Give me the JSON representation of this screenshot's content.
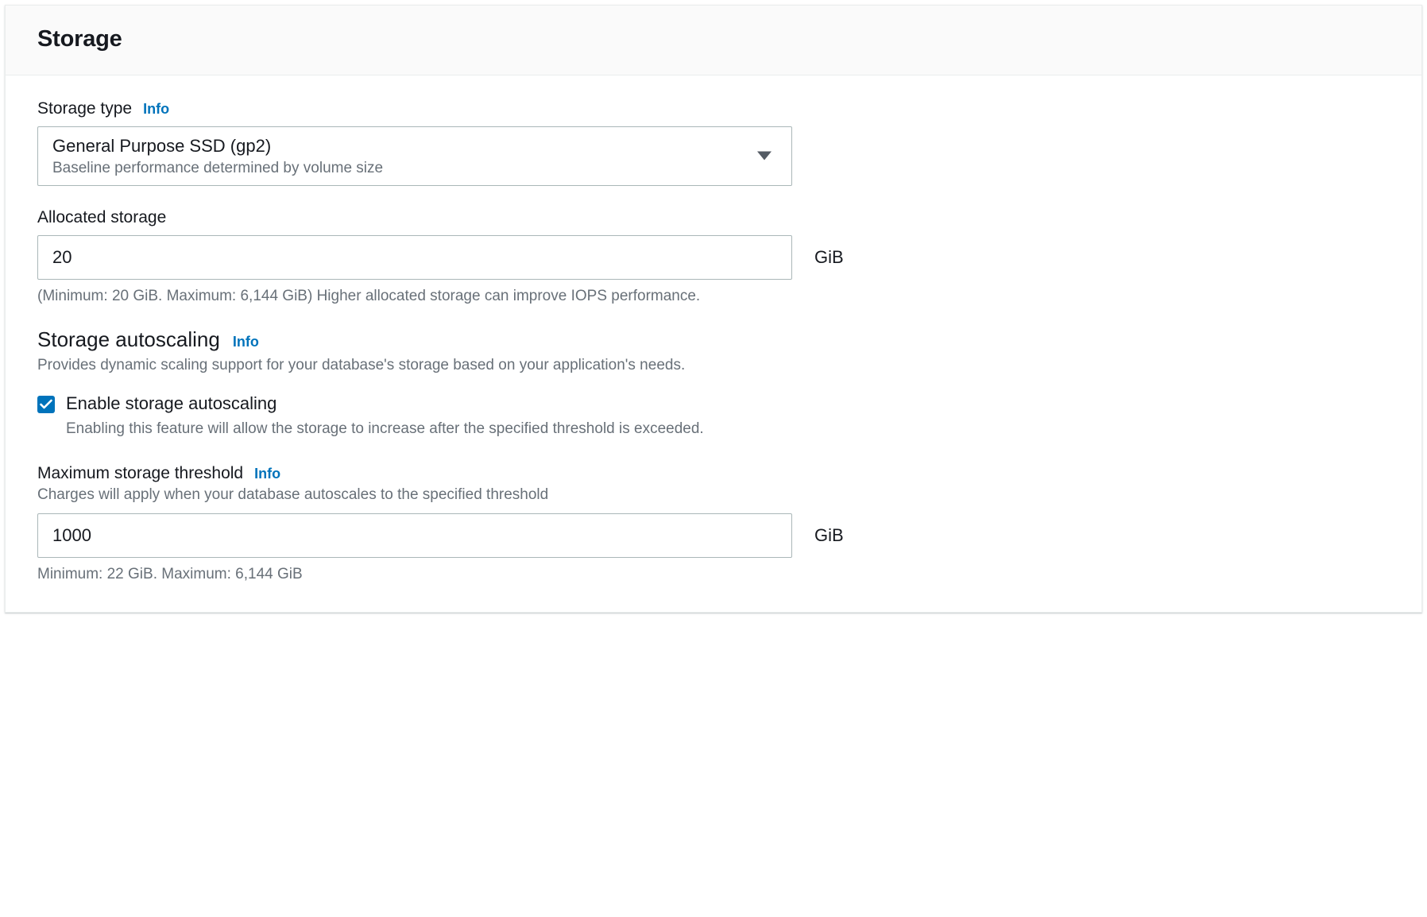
{
  "panel": {
    "title": "Storage"
  },
  "storage_type": {
    "label": "Storage type",
    "info": "Info",
    "value": "General Purpose SSD (gp2)",
    "description": "Baseline performance determined by volume size"
  },
  "allocated_storage": {
    "label": "Allocated storage",
    "value": "20",
    "unit": "GiB",
    "help": "(Minimum: 20 GiB. Maximum: 6,144 GiB) Higher allocated storage can improve IOPS performance."
  },
  "autoscaling": {
    "heading": "Storage autoscaling",
    "info": "Info",
    "description": "Provides dynamic scaling support for your database's storage based on your application's needs.",
    "checkbox_label": "Enable storage autoscaling",
    "checkbox_description": "Enabling this feature will allow the storage to increase after the specified threshold is exceeded.",
    "checked": true
  },
  "max_threshold": {
    "label": "Maximum storage threshold",
    "info": "Info",
    "description": "Charges will apply when your database autoscales to the specified threshold",
    "value": "1000",
    "unit": "GiB",
    "help": "Minimum: 22 GiB. Maximum: 6,144 GiB"
  }
}
